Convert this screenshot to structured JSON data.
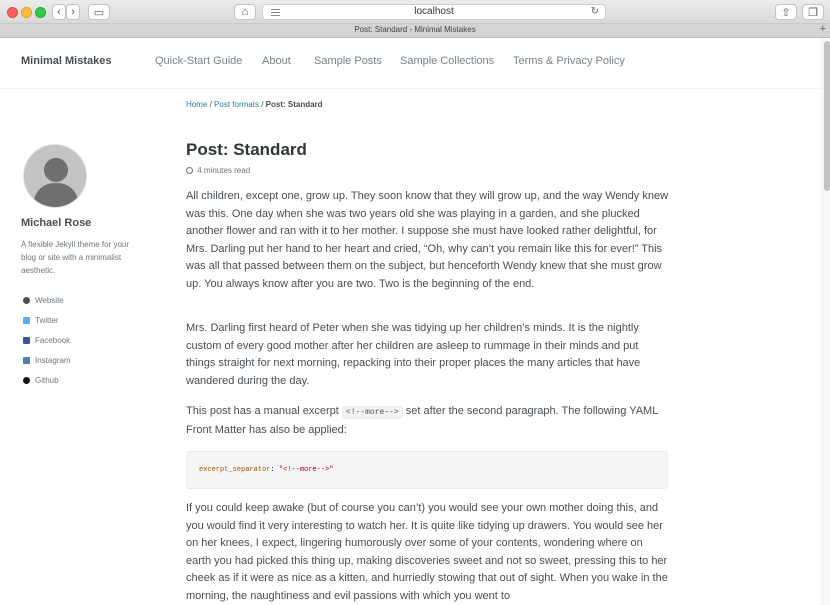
{
  "browser": {
    "address": "localhost",
    "tab_title": "Post: Standard - Minimal Mistakes",
    "new_tab": "+"
  },
  "site": {
    "title": "Minimal Mistakes",
    "nav": [
      "Quick-Start Guide",
      "About",
      "Sample Posts",
      "Sample Collections",
      "Terms & Privacy Policy"
    ]
  },
  "author": {
    "name": "Michael Rose",
    "bio": "A flexible Jekyll theme for your blog or site with a minimalist aesthetic.",
    "links": [
      {
        "label": "Website",
        "icon": "globe-icon",
        "color": "#494e52"
      },
      {
        "label": "Twitter",
        "icon": "twitter-icon",
        "color": "#55acee"
      },
      {
        "label": "Facebook",
        "icon": "facebook-icon",
        "color": "#3b5998"
      },
      {
        "label": "Instagram",
        "icon": "instagram-icon",
        "color": "#517fa4"
      },
      {
        "label": "Github",
        "icon": "github-icon",
        "color": "#171516"
      }
    ]
  },
  "breadcrumbs": {
    "home": "Home",
    "sep": "/",
    "section": "Post formats",
    "current": "Post: Standard"
  },
  "post": {
    "title": "Post: Standard",
    "read_time": "4 minutes read",
    "p1": "All children, except one, grow up. They soon know that they will grow up, and the way Wendy knew was this. One day when she was two years old she was playing in a garden, and she plucked another flower and ran with it to her mother. I suppose she must have looked rather delightful, for Mrs. Darling put her hand to her heart and cried, “Oh, why can’t you remain like this for ever!” This was all that passed between them on the subject, but henceforth Wendy knew that she must grow up. You always know after you are two. Two is the beginning of the end.",
    "p2": "Mrs. Darling first heard of Peter when she was tidying up her children’s minds. It is the nightly custom of every good mother after her children are asleep to rummage in their minds and put things straight for next morning, repacking into their proper places the many articles that have wandered during the day.",
    "p3_before": "This post has a manual excerpt ",
    "p3_code": "<!--more-->",
    "p3_after": " set after the second paragraph. The following YAML Front Matter has also be applied:",
    "code_key": "excerpt_separator",
    "code_colon": ": ",
    "code_value": "\"<!--more-->\"",
    "p4": "If you could keep awake (but of course you can’t) you would see your own mother doing this, and you would find it very interesting to watch her. It is quite like tidying up drawers. You would see her on her knees, I expect, lingering humorously over some of your contents, wondering where on earth you had picked this thing up, making discoveries sweet and not so sweet, pressing this to her cheek as if it were as nice as a kitten, and hurriedly stowing that out of sight. When you wake in the morning, the naughtiness and evil passions with which you went to"
  }
}
